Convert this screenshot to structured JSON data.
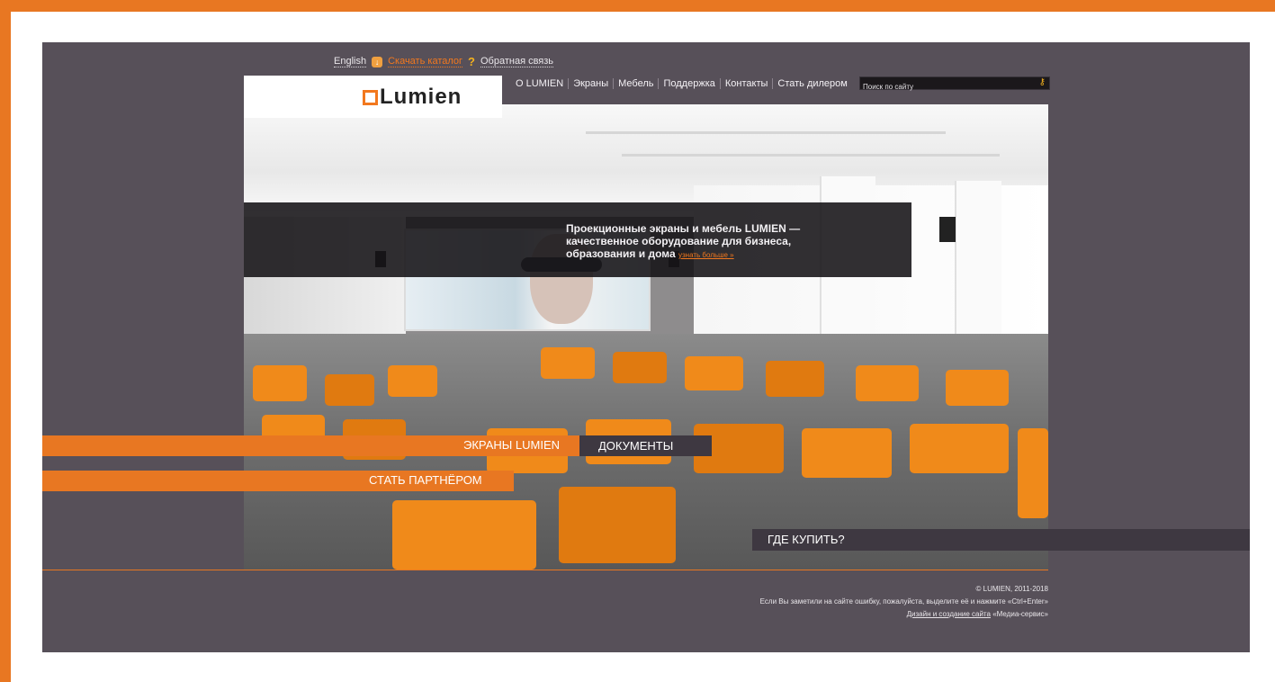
{
  "topbar": {
    "english": "English",
    "catalog": "Скачать каталог",
    "feedback": "Обратная связь"
  },
  "logo": {
    "text": "Lumien"
  },
  "nav": {
    "items": [
      "О LUMIEN",
      "Экраны",
      "Мебель",
      "Поддержка",
      "Контакты",
      "Стать дилером"
    ]
  },
  "search": {
    "placeholder": "Поиск по сайту"
  },
  "banner": {
    "line1": "Проекционные экраны и мебель LUMIEN —",
    "line2": "качественное оборудование для бизнеса,",
    "line3": "образования и дома",
    "more": "узнать больше »"
  },
  "buttons": {
    "screens": "ЭКРАНЫ LUMIEN",
    "documents": "ДОКУМЕНТЫ",
    "partner": "СТАТЬ ПАРТНЁРОМ",
    "buy": "ГДЕ КУПИТЬ?"
  },
  "footer": {
    "copyright": "© LUMIEN, 2011-2018",
    "notice": "Если Вы заметили на сайте ошибку, пожалуйста, выделите её и нажмите «Ctrl+Enter»",
    "design_link": "Дизайн и создание сайта",
    "design_name": "«Медиа-сервис»"
  },
  "colors": {
    "accent": "#e87722",
    "page_bg": "#575059",
    "dark_button": "#3e3841"
  },
  "icons": [
    "download-icon",
    "question-icon",
    "search-key-icon"
  ]
}
